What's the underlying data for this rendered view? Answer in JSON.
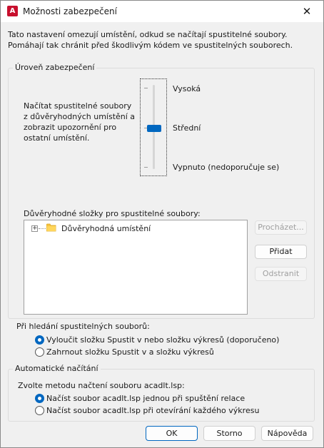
{
  "window": {
    "title": "Možnosti zabezpečení",
    "app_icon_letter": "A",
    "close_glyph": "✕"
  },
  "intro_text": "Tato nastavení omezují umístění, odkud se načítají spustitelné soubory.  Pomáhají tak chránit před škodlivým kódem ve spustitelných souborech.",
  "security_level": {
    "group_label": "Úroveň zabezpečení",
    "description": "Načítat spustitelné soubory z důvěryhodných umístění a zobrazit upozornění pro ostatní umístění.",
    "levels": [
      "Vysoká",
      "Střední",
      "Vypnuto (nedoporučuje se)"
    ],
    "selected": "Střední"
  },
  "trusted_folders": {
    "label": "Důvěryhodné složky pro spustitelné soubory:",
    "tree_items": [
      {
        "label": "Důvěryhodná umístění",
        "expander": "+"
      }
    ],
    "buttons": {
      "browse": "Procházet...",
      "add": "Přidat",
      "remove": "Odstranit"
    }
  },
  "search": {
    "label": "Při hledání spustitelných souborů:",
    "options": [
      "Vyloučit složku Spustit v nebo složku výkresů (doporučeno)",
      "Zahrnout složku Spustit v a složku výkresů"
    ],
    "selected_index": 0
  },
  "autoload": {
    "group_label": "Automatické načítání",
    "prompt": "Zvolte metodu načtení souboru acadlt.lsp:",
    "options": [
      "Načíst soubor acadlt.lsp jednou při spuštění relace",
      "Načíst soubor acadlt.lsp při otevírání každého výkresu"
    ],
    "selected_index": 0
  },
  "footer": {
    "ok": "OK",
    "cancel": "Storno",
    "help": "Nápověda"
  },
  "colors": {
    "accent": "#0067c0",
    "app_icon": "#c8102e",
    "folder": "#f5c443"
  }
}
